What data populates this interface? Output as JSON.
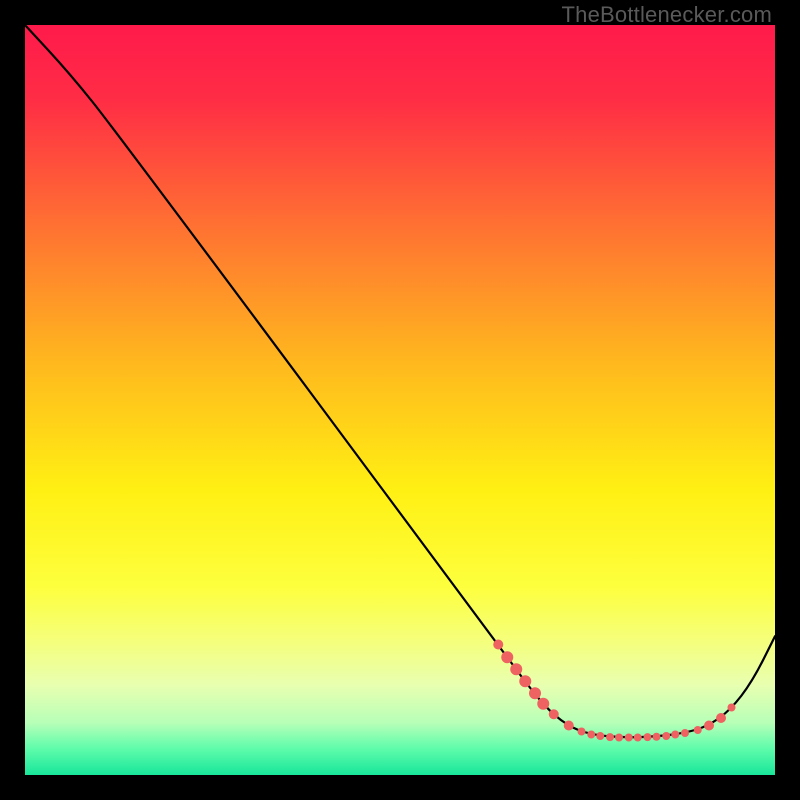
{
  "attribution": "TheBottlenecker.com",
  "chart_data": {
    "type": "line",
    "title": "",
    "xlabel": "",
    "ylabel": "",
    "xlim": [
      0,
      100
    ],
    "ylim": [
      0,
      100
    ],
    "gradient_stops": [
      {
        "offset": 0.0,
        "color": "#ff1a4b"
      },
      {
        "offset": 0.1,
        "color": "#ff2d45"
      },
      {
        "offset": 0.25,
        "color": "#ff6a34"
      },
      {
        "offset": 0.45,
        "color": "#ffb81e"
      },
      {
        "offset": 0.62,
        "color": "#fff013"
      },
      {
        "offset": 0.75,
        "color": "#fdff3e"
      },
      {
        "offset": 0.82,
        "color": "#f5ff7a"
      },
      {
        "offset": 0.88,
        "color": "#e8ffb0"
      },
      {
        "offset": 0.93,
        "color": "#b8ffb8"
      },
      {
        "offset": 0.965,
        "color": "#5efcab"
      },
      {
        "offset": 1.0,
        "color": "#18e69a"
      }
    ],
    "series": [
      {
        "name": "bottleneck-curve",
        "points": [
          {
            "x": 0,
            "y": 100
          },
          {
            "x": 6,
            "y": 93.5
          },
          {
            "x": 12,
            "y": 86
          },
          {
            "x": 63,
            "y": 17.5
          },
          {
            "x": 67,
            "y": 12
          },
          {
            "x": 70,
            "y": 8.4
          },
          {
            "x": 73,
            "y": 6.2
          },
          {
            "x": 76,
            "y": 5.3
          },
          {
            "x": 80,
            "y": 5.0
          },
          {
            "x": 84,
            "y": 5.1
          },
          {
            "x": 88,
            "y": 5.6
          },
          {
            "x": 91,
            "y": 6.5
          },
          {
            "x": 94,
            "y": 8.6
          },
          {
            "x": 97,
            "y": 12.5
          },
          {
            "x": 100,
            "y": 18.5
          }
        ]
      }
    ],
    "markers": [
      {
        "x": 63.1,
        "y": 17.4,
        "r": 5
      },
      {
        "x": 64.3,
        "y": 15.7,
        "r": 6
      },
      {
        "x": 65.5,
        "y": 14.1,
        "r": 6
      },
      {
        "x": 66.7,
        "y": 12.5,
        "r": 6
      },
      {
        "x": 68.0,
        "y": 10.9,
        "r": 6
      },
      {
        "x": 69.1,
        "y": 9.5,
        "r": 6
      },
      {
        "x": 70.5,
        "y": 8.1,
        "r": 5
      },
      {
        "x": 72.5,
        "y": 6.6,
        "r": 5
      },
      {
        "x": 74.2,
        "y": 5.8,
        "r": 4
      },
      {
        "x": 75.5,
        "y": 5.4,
        "r": 4
      },
      {
        "x": 76.7,
        "y": 5.2,
        "r": 4
      },
      {
        "x": 78.0,
        "y": 5.05,
        "r": 4
      },
      {
        "x": 79.2,
        "y": 5.0,
        "r": 4
      },
      {
        "x": 80.5,
        "y": 5.0,
        "r": 4
      },
      {
        "x": 81.7,
        "y": 5.0,
        "r": 4
      },
      {
        "x": 83.0,
        "y": 5.05,
        "r": 4
      },
      {
        "x": 84.2,
        "y": 5.1,
        "r": 4
      },
      {
        "x": 85.5,
        "y": 5.2,
        "r": 4
      },
      {
        "x": 86.7,
        "y": 5.4,
        "r": 4
      },
      {
        "x": 88.0,
        "y": 5.6,
        "r": 4
      },
      {
        "x": 89.7,
        "y": 6.0,
        "r": 4
      },
      {
        "x": 91.2,
        "y": 6.6,
        "r": 5
      },
      {
        "x": 92.8,
        "y": 7.6,
        "r": 5
      },
      {
        "x": 94.2,
        "y": 9.0,
        "r": 4
      }
    ],
    "marker_color": "#ee6262"
  }
}
